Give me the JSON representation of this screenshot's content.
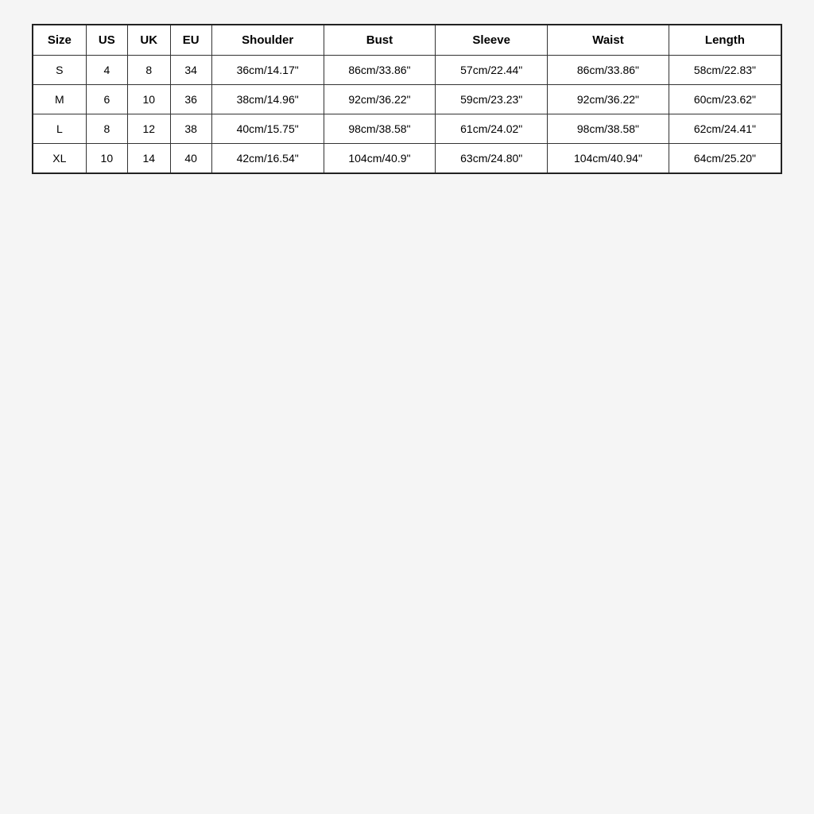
{
  "table": {
    "headers": [
      "Size",
      "US",
      "UK",
      "EU",
      "Shoulder",
      "Bust",
      "Sleeve",
      "Waist",
      "Length"
    ],
    "rows": [
      {
        "size": "S",
        "us": "4",
        "uk": "8",
        "eu": "34",
        "shoulder": "36cm/14.17\"",
        "bust": "86cm/33.86\"",
        "sleeve": "57cm/22.44\"",
        "waist": "86cm/33.86\"",
        "length": "58cm/22.83\""
      },
      {
        "size": "M",
        "us": "6",
        "uk": "10",
        "eu": "36",
        "shoulder": "38cm/14.96\"",
        "bust": "92cm/36.22\"",
        "sleeve": "59cm/23.23\"",
        "waist": "92cm/36.22\"",
        "length": "60cm/23.62\""
      },
      {
        "size": "L",
        "us": "8",
        "uk": "12",
        "eu": "38",
        "shoulder": "40cm/15.75\"",
        "bust": "98cm/38.58\"",
        "sleeve": "61cm/24.02\"",
        "waist": "98cm/38.58\"",
        "length": "62cm/24.41\""
      },
      {
        "size": "XL",
        "us": "10",
        "uk": "14",
        "eu": "40",
        "shoulder": "42cm/16.54\"",
        "bust": "104cm/40.9\"",
        "sleeve": "63cm/24.80\"",
        "waist": "104cm/40.94\"",
        "length": "64cm/25.20\""
      }
    ]
  }
}
